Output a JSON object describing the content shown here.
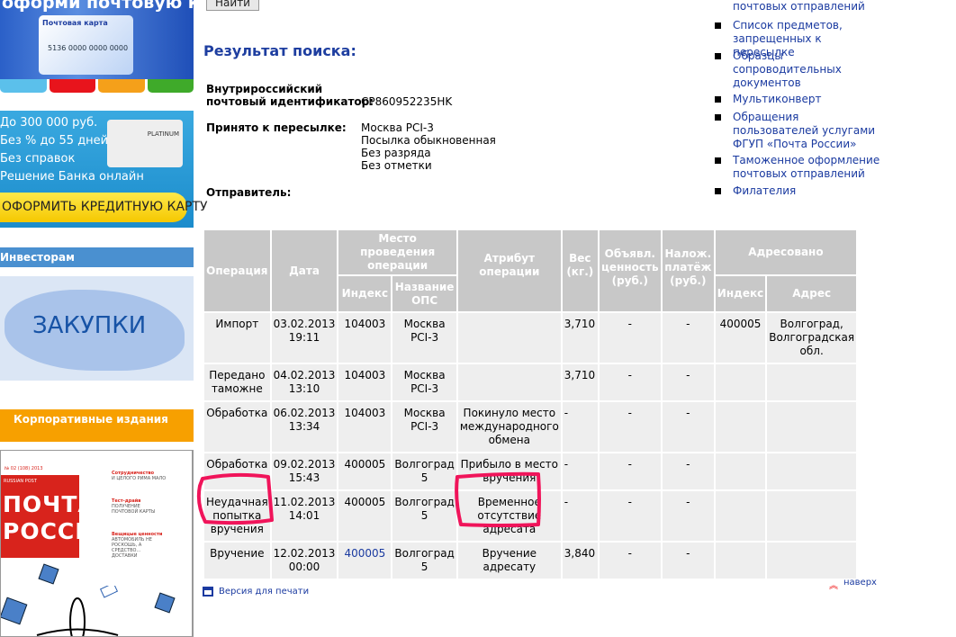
{
  "banners": {
    "postal_card": {
      "headline": "оформи почтовую карту!",
      "card_title": "Почтовая карта",
      "card_number": "5136 0000 0000 0000",
      "strip_colors": [
        "#5bc0eb",
        "#e8141c",
        "#f5a01a",
        "#3faa2a"
      ]
    },
    "credit_card": {
      "lines": [
        "До 300 000 руб.",
        "Без % до 55 дней",
        "Без справок",
        "Решение Банка онлайн"
      ],
      "card_text": "PLATINUM",
      "button": "ОФОРМИТЬ КРЕДИТНУЮ КАРТУ"
    },
    "investors": "Инвесторам",
    "procurement": "ЗАКУПКИ",
    "corporate": "Корпоративные издания",
    "magazine": {
      "issue": "№ 02 (108) 2013",
      "brand": "RUSSIAN POST",
      "title_line1": "ПОЧТА",
      "title_line2": "РОССИИ",
      "headlines": [
        {
          "h": "Сотрудничество",
          "t": "И ЦЕЛОГО РИМА МАЛО"
        },
        {
          "h": "Тест-драйв",
          "t": "ПОЛУЧЕНИЕ ПОЧТОВОЙ КАРТЫ"
        },
        {
          "h": "Вещицые ценности",
          "t": "АВТОМОБИЛЬ НЕ РОСКОШЬ, А СРЕДСТВО... ДОСТАВКИ"
        }
      ]
    }
  },
  "search": {
    "button": "Найти"
  },
  "result": {
    "title": "Результат поиска:",
    "id_label_1": "Внутрироссийский",
    "id_label_2": "почтовый идентификатор:",
    "id_value": "CP860952235HK",
    "accepted_label": "Принято к пересылке:",
    "accepted_values": [
      "Москва PCI-3",
      "Посылка обыкновенная",
      "Без разряда",
      "Без отметки"
    ],
    "sender_label": "Отправитель:"
  },
  "table": {
    "headers": {
      "operation": "Операция",
      "date": "Дата",
      "place": "Место проведения операции",
      "index": "Индекс",
      "ops_name": "Название ОПС",
      "attribute": "Атрибут операции",
      "weight": "Вес (кг.)",
      "declared": "Объявл. ценность (руб.)",
      "cod": "Налож. платёж (руб.)",
      "addressed": "Адресовано",
      "addr_index": "Индекс",
      "address": "Адрес"
    },
    "rows": [
      {
        "op": "Импорт",
        "date": "03.02.2013 19:11",
        "index": "104003",
        "ops": "Москва PCI-3",
        "attr": "",
        "weight": "3,710",
        "declared": "-",
        "cod": "-",
        "to_index": "400005",
        "to_addr": "Волгоград, Волгоградская обл."
      },
      {
        "op": "Передано таможне",
        "date": "04.02.2013 13:10",
        "index": "104003",
        "ops": "Москва PCI-3",
        "attr": "",
        "weight": "3,710",
        "declared": "-",
        "cod": "-",
        "to_index": "",
        "to_addr": ""
      },
      {
        "op": "Обработка",
        "date": "06.02.2013 13:34",
        "index": "104003",
        "ops": "Москва PCI-3",
        "attr": "Покинуло место международного обмена",
        "weight": "-",
        "declared": "-",
        "cod": "-",
        "to_index": "",
        "to_addr": ""
      },
      {
        "op": "Обработка",
        "date": "09.02.2013 15:43",
        "index": "400005",
        "ops": "Волгоград 5",
        "attr": "Прибыло в место вручения",
        "weight": "-",
        "declared": "-",
        "cod": "-",
        "to_index": "",
        "to_addr": ""
      },
      {
        "op": "Неудачная попытка вручения",
        "date": "11.02.2013 14:01",
        "index": "400005",
        "ops": "Волгоград 5",
        "attr": "Временное отсутствие адресата",
        "weight": "-",
        "declared": "-",
        "cod": "-",
        "to_index": "",
        "to_addr": ""
      },
      {
        "op": "Вручение",
        "date": "12.02.2013 00:00",
        "index": "400005",
        "ops": "Волгоград 5",
        "attr": "Вручение адресату",
        "weight": "3,840",
        "declared": "-",
        "cod": "-",
        "to_index": "",
        "to_addr": ""
      }
    ]
  },
  "footer": {
    "print": "Версия для печати",
    "top": "наверх"
  },
  "right_links": [
    "почтовых отправлений",
    "Список предметов, запрещенных к пересылке",
    "Образцы сопроводительных документов",
    "Мультиконверт",
    "Обращения пользователей услугами ФГУП «Почта России»",
    "Таможенное оформление почтовых отправлений",
    "Филателия"
  ],
  "colors": {
    "link": "#1a3aa0",
    "title": "#1e3ea0",
    "header_bg": "#c8c8c8",
    "cell_bg": "#eeeeee",
    "marker": "#f0145a"
  }
}
